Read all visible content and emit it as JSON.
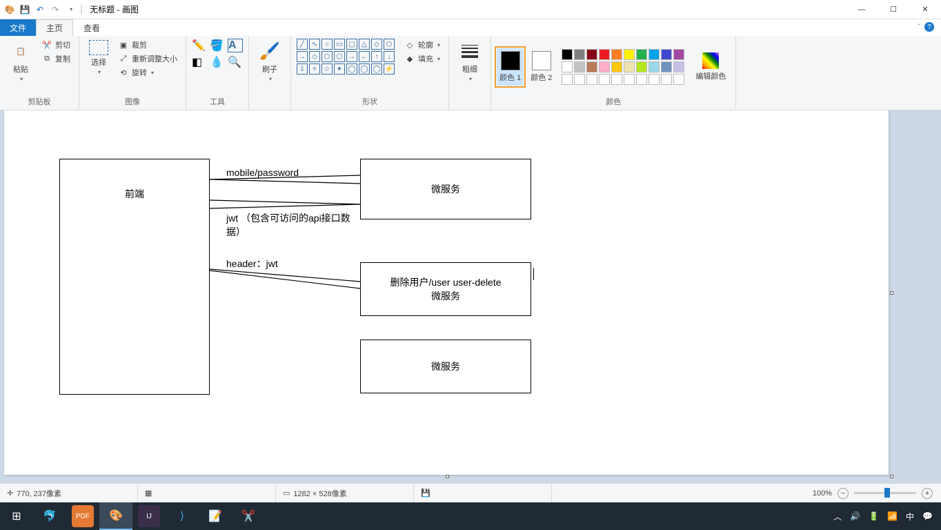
{
  "title": "无标题 - 画图",
  "tabs": {
    "file": "文件",
    "home": "主页",
    "view": "查看"
  },
  "ribbon": {
    "clipboard": {
      "label": "剪贴板",
      "paste": "粘贴",
      "cut": "剪切",
      "copy": "复制"
    },
    "image": {
      "label": "图像",
      "select": "选择",
      "crop": "裁剪",
      "resize": "重新调整大小",
      "rotate": "旋转"
    },
    "tools": {
      "label": "工具"
    },
    "brush": {
      "label": "刷子"
    },
    "shapes": {
      "label": "形状",
      "outline": "轮廓",
      "fill": "填充"
    },
    "size": {
      "label": "粗细"
    },
    "colors": {
      "label": "颜色",
      "color1": "颜色 1",
      "color2": "颜色 2",
      "edit": "编辑颜色",
      "palette_row1": [
        "#000000",
        "#7f7f7f",
        "#880015",
        "#ed1c24",
        "#ff7f27",
        "#fff200",
        "#22b14c",
        "#00a2e8",
        "#3f48cc",
        "#a349a4"
      ],
      "palette_row2": [
        "#ffffff",
        "#c3c3c3",
        "#b97a57",
        "#ffaec9",
        "#ffc90e",
        "#efe4b0",
        "#b5e61d",
        "#99d9ea",
        "#7092be",
        "#c8bfe7"
      ]
    }
  },
  "canvas": {
    "box_frontend": "前端",
    "box_svc1": "微服务",
    "box_svc2": "删除用户/user   user-delete\n微服务",
    "box_svc3": "微服务",
    "lbl_mobile": "mobile/password",
    "lbl_jwt": "jwt （包含可访问的api接口数据）",
    "lbl_header": "header：jwt"
  },
  "status": {
    "coords": "770, 237像素",
    "size": "1282 × 528像素",
    "zoom": "100%"
  },
  "tray": {
    "ime": "中"
  }
}
